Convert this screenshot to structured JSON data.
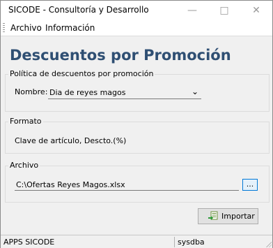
{
  "window": {
    "title": "SICODE - Consultoría y Desarrollo",
    "controls": [
      "minimize-icon",
      "maximize-icon",
      "close-icon"
    ]
  },
  "menu": {
    "items": [
      {
        "label": "Archivo"
      },
      {
        "label": "Información"
      }
    ]
  },
  "page": {
    "heading": "Descuentos por Promoción",
    "heading_color": "#2f4f73"
  },
  "policy_group": {
    "legend": "Política de descuentos por promoción",
    "nombre_label": "Nombre:",
    "nombre_value": "Dia de reyes magos"
  },
  "format_group": {
    "legend": "Formato",
    "text": "Clave de artículo, Descto.(%)"
  },
  "file_group": {
    "legend": "Archivo",
    "path_value": "C:\\Ofertas Reyes Magos.xlsx",
    "browse_label": "..."
  },
  "actions": {
    "import_label": "Importar",
    "import_icon": "import-excel-icon"
  },
  "status": {
    "left": "APPS SICODE",
    "right": "sysdba"
  }
}
